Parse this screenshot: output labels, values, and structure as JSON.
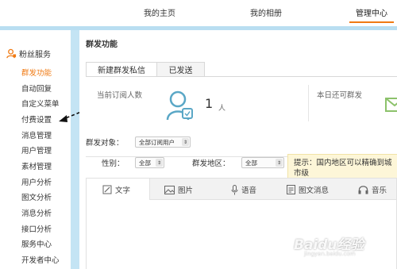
{
  "topnav": {
    "tabs": [
      {
        "label": "我的主页"
      },
      {
        "label": "我的相册"
      },
      {
        "label": "管理中心"
      }
    ],
    "active_color": "#f07a13"
  },
  "sidebar": {
    "section_title": "粉丝服务",
    "items": [
      {
        "label": "群发功能",
        "active": true
      },
      {
        "label": "自动回复"
      },
      {
        "label": "自定义菜单"
      },
      {
        "label": "付费设置"
      },
      {
        "label": "消息管理"
      },
      {
        "label": "用户管理"
      },
      {
        "label": "素材管理"
      },
      {
        "label": "用户分析"
      },
      {
        "label": "图文分析"
      },
      {
        "label": "消息分析"
      },
      {
        "label": "接口分析"
      },
      {
        "label": "服务中心"
      },
      {
        "label": "开发者中心"
      }
    ]
  },
  "main": {
    "title": "群发功能",
    "tabs": [
      {
        "label": "新建群发私信"
      },
      {
        "label": "已发送"
      }
    ],
    "stats": {
      "subscribers_label": "当前订阅人数",
      "subscribers_value": "1",
      "subscribers_unit": "人",
      "remaining_label": "本日还可群发"
    },
    "form": {
      "target_label": "群发对象：",
      "target_value": "全部订阅用户",
      "gender_label": "性别：",
      "gender_value": "全部",
      "region_label": "群发地区：",
      "region_value": "全部"
    },
    "tip": "提示：国内地区可以精确到城市级",
    "toolbar": [
      {
        "label": "文字",
        "icon": "pencil-icon"
      },
      {
        "label": "图片",
        "icon": "image-icon"
      },
      {
        "label": "语音",
        "icon": "microphone-icon"
      },
      {
        "label": "图文消息",
        "icon": "article-icon"
      },
      {
        "label": "音乐",
        "icon": "headphones-icon"
      }
    ]
  },
  "watermark": {
    "text": "Baidu经验",
    "sub": "jingyan.baidu.com"
  }
}
